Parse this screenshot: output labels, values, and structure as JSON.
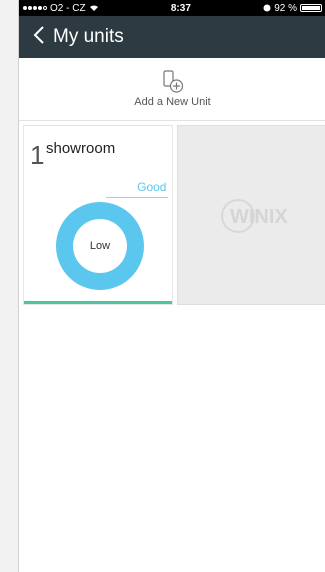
{
  "status": {
    "carrier": "O2 - CZ",
    "time": "8:37",
    "battery": "92 %"
  },
  "nav": {
    "title": "My units"
  },
  "add": {
    "label": "Add a New Unit"
  },
  "units": [
    {
      "number": "1",
      "name": "showroom",
      "air_quality": "Good",
      "fan_speed": "Low"
    }
  ],
  "placeholder": {
    "logo_text": "WINIX"
  },
  "colors": {
    "navbar": "#2d3a41",
    "accent": "#5bc6ee",
    "active_underline": "#4ec3a0"
  }
}
